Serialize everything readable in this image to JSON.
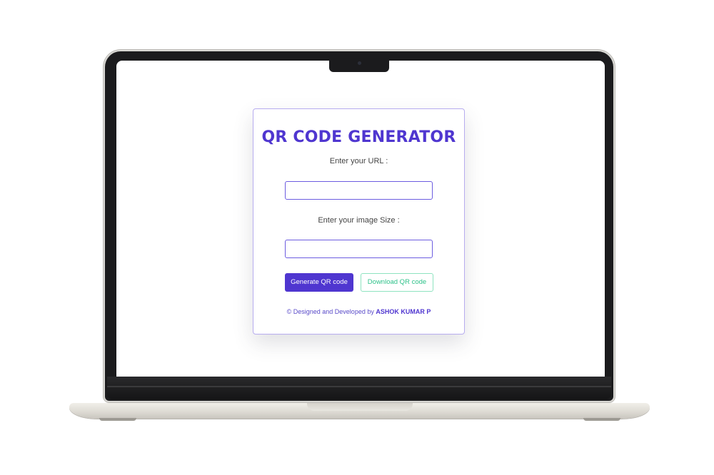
{
  "app": {
    "title": "QR CODE GENERATOR",
    "url_label": "Enter your URL :",
    "url_value": "",
    "size_label": "Enter your image Size :",
    "size_value": "",
    "generate_label": "Generate QR code",
    "download_label": "Download QR code",
    "footer_prefix": "© Designed and Developed by",
    "footer_author": "ASHOK KUMAR P"
  },
  "colors": {
    "accent": "#4f36d0",
    "download": "#2fc28a",
    "border": "#b7acef"
  }
}
